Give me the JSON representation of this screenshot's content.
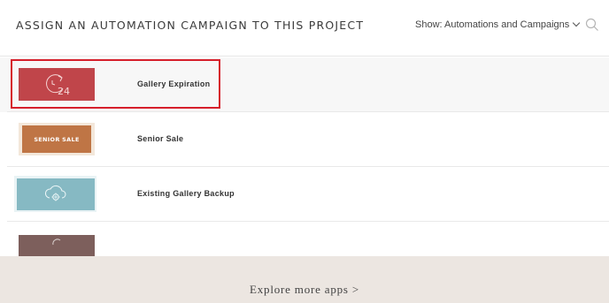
{
  "header": {
    "title": "ASSIGN AN AUTOMATION CAMPAIGN TO THIS PROJECT",
    "filter_label": "Show: Automations and Campaigns",
    "search_icon": "search-icon"
  },
  "list": {
    "items": [
      {
        "name": "Gallery Expiration",
        "thumb_color": "#c0454a",
        "thumb_icon": "clock-24-icon",
        "thumb_text": "",
        "selected": true
      },
      {
        "name": "Senior Sale",
        "thumb_color": "#bf7545",
        "thumb_icon": "",
        "thumb_text": "SENIOR SALE",
        "selected": false
      },
      {
        "name": "Existing Gallery Backup",
        "thumb_color": "#86b9c3",
        "thumb_icon": "cloud-gear-icon",
        "thumb_text": "",
        "selected": false
      },
      {
        "name": "",
        "thumb_color": "#7d5f5c",
        "thumb_icon": "",
        "thumb_text": "",
        "selected": false
      }
    ]
  },
  "footer": {
    "explore_label": "Explore more apps >",
    "background": "#ece6e1"
  },
  "colors": {
    "highlight": "#d61f2b"
  }
}
